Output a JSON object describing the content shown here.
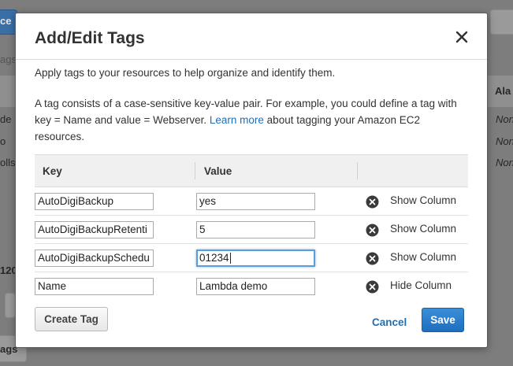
{
  "background": {
    "top_button_fragment": "ce",
    "tab_fragment": "ags",
    "right_col_header": "Ala",
    "left_row_fragments": [
      "de",
      "o",
      "olls"
    ],
    "right_row_values": [
      "Non",
      "Non",
      "Non"
    ],
    "left_count_fragment": "120",
    "bottom_button_fragment": "ags"
  },
  "modal": {
    "title": "Add/Edit Tags",
    "intro": "Apply tags to your resources to help organize and identify them.",
    "description_before_link": "A tag consists of a case-sensitive key-value pair. For example, you could define a tag with key = Name and value = Webserver. ",
    "learn_more_link": "Learn more",
    "description_after_link": " about tagging your Amazon EC2 resources.",
    "table": {
      "key_header": "Key",
      "value_header": "Value",
      "rows": [
        {
          "key": "AutoDigiBackup",
          "value": "yes",
          "column_action": "Show Column"
        },
        {
          "key": "AutoDigiBackupRetenti",
          "value": "5",
          "column_action": "Show Column"
        },
        {
          "key": "AutoDigiBackupSchedu",
          "value": "01234",
          "column_action": "Show Column"
        },
        {
          "key": "Name",
          "value": "Lambda demo",
          "column_action": "Hide Column"
        }
      ]
    },
    "create_tag_label": "Create Tag",
    "cancel_label": "Cancel",
    "save_label": "Save"
  },
  "colors": {
    "link": "#1f6fb4",
    "save_button": "#2a7fcf",
    "focus_ring": "#5b9dd9"
  },
  "icons": {
    "close": "close-icon",
    "remove_row": "remove-circle-icon"
  }
}
